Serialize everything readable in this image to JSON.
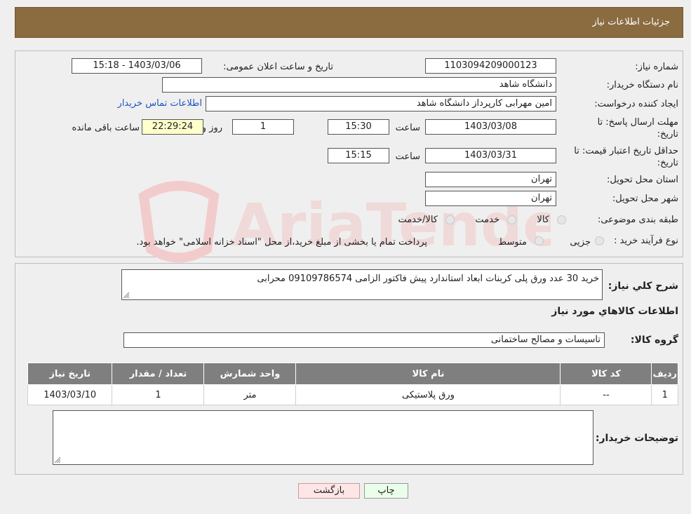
{
  "header": {
    "title": "جزئیات اطلاعات نیاز"
  },
  "form": {
    "need_number_label": "شماره نیاز:",
    "need_number": "1103094209000123",
    "announce_label": "تاریخ و ساعت اعلان عمومی:",
    "announce_value": "1403/03/06 - 15:18",
    "buyer_org_label": "نام دستگاه خریدار:",
    "buyer_org": "دانشگاه شاهد",
    "requester_label": "ایجاد کننده درخواست:",
    "requester": "امین مهرابی کارپرداز دانشگاه شاهد",
    "contact_link": "اطلاعات تماس خریدار",
    "deadline_label_1": "مهلت ارسال پاسخ: تا",
    "deadline_label_2": "تاریخ:",
    "deadline_date": "1403/03/08",
    "time_label": "ساعت",
    "deadline_time": "15:30",
    "days_value": "1",
    "days_label": "روز و",
    "remaining_time": "22:29:24",
    "remaining_label": "ساعت باقی مانده",
    "validity_label_1": "حداقل تاریخ اعتبار قیمت: تا",
    "validity_label_2": "تاریخ:",
    "validity_date": "1403/03/31",
    "validity_time_label": "ساعت",
    "validity_time": "15:15",
    "province_label": "استان محل تحویل:",
    "province": "تهران",
    "city_label": "شهر محل تحویل:",
    "city": "تهران",
    "category_label": "طبقه بندی موضوعی:",
    "category_options": [
      "کالا",
      "خدمت",
      "کالا/خدمت"
    ],
    "process_label": "نوع فرآیند خرید :",
    "process_options": [
      "جزیی",
      "متوسط"
    ],
    "process_note": "پرداخت تمام یا بخشی از مبلغ خرید،از محل \"اسناد خزانه اسلامی\" خواهد بود."
  },
  "description": {
    "label": "شرح کلي نياز:",
    "text": "خرید 30 عدد ورق پلی کربنات ابعاد استاندارد پیش فاکتور الزامی 09109786574 محرابی"
  },
  "goods": {
    "section_title": "اطلاعات کالاهاي مورد نياز",
    "group_label": "گروه کالا:",
    "group_value": "تاسیسات و مصالح ساختمانی",
    "columns": [
      "ردیف",
      "کد کالا",
      "نام کالا",
      "واحد شمارش",
      "تعداد / مقدار",
      "تاریخ نیاز"
    ],
    "rows": [
      [
        "1",
        "--",
        "ورق پلاستیکی",
        "متر",
        "1",
        "1403/03/10"
      ]
    ]
  },
  "buyer_notes": {
    "label": "توضیحات خریدار:",
    "text": ""
  },
  "buttons": {
    "print": "چاپ",
    "back": "بازگشت"
  },
  "watermark": {
    "text": "AriaTender.neT"
  },
  "colors": {
    "header_bg": "#8b6c41",
    "table_header_bg": "#7f7f7f",
    "print_btn_bg": "#eaffea",
    "back_btn_bg": "#ffe6e6"
  }
}
